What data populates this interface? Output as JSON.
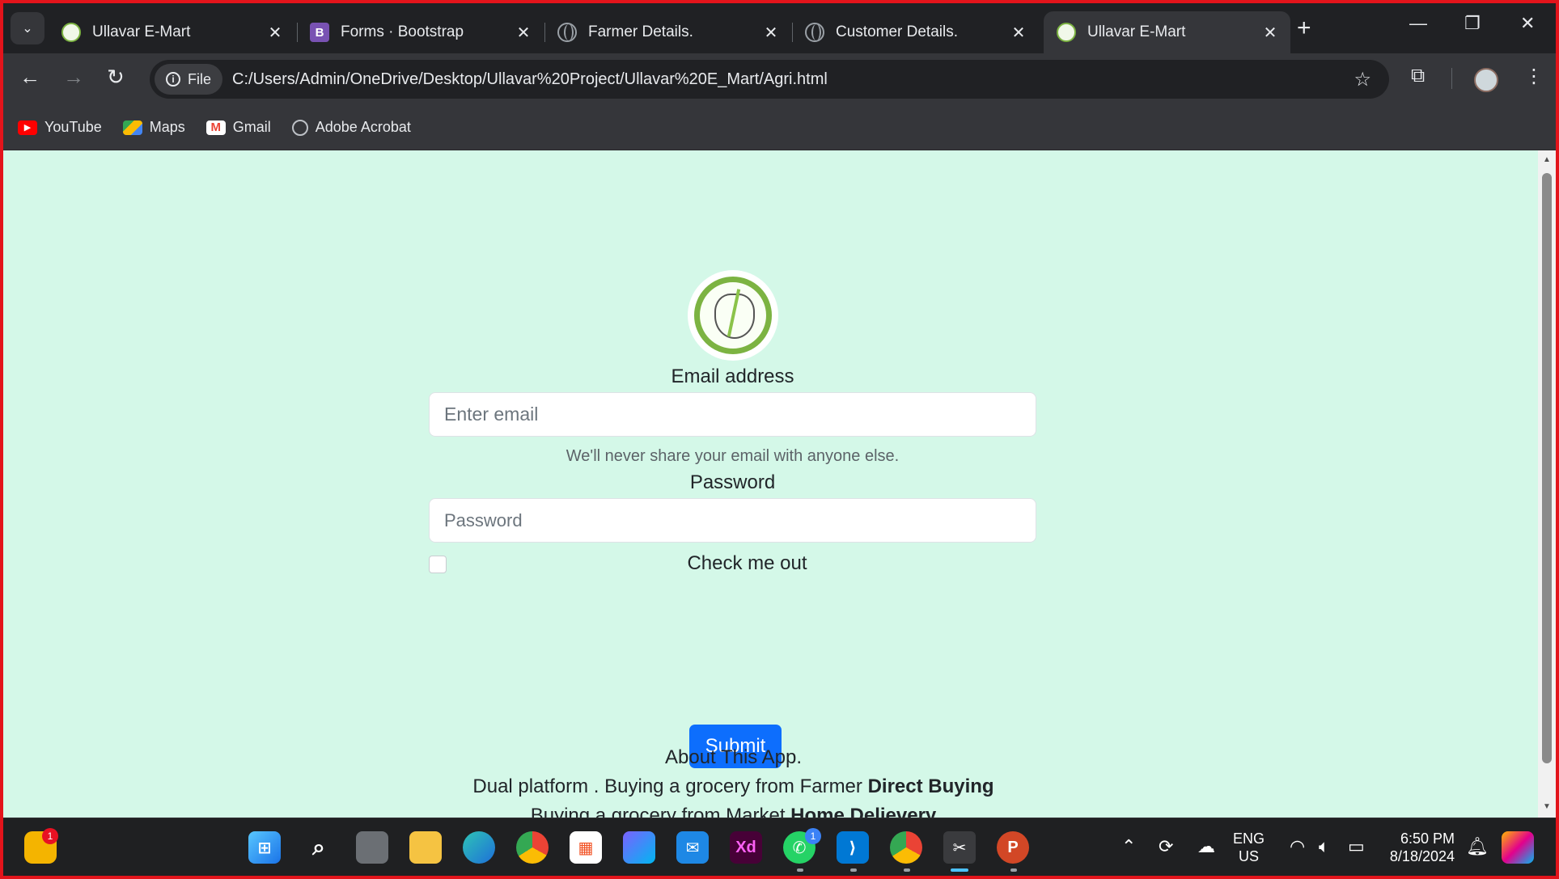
{
  "browser": {
    "tabs": [
      {
        "title": "Ullavar E-Mart",
        "icon": "ullavar-logo-icon"
      },
      {
        "title": "Forms · Bootstrap",
        "icon": "bootstrap-icon"
      },
      {
        "title": "Farmer Details.",
        "icon": "globe-icon"
      },
      {
        "title": "Customer Details.",
        "icon": "globe-icon"
      },
      {
        "title": "Ullavar E-Mart",
        "icon": "ullavar-logo-icon",
        "active": true
      }
    ],
    "site_chip": "File",
    "url": "C:/Users/Admin/OneDrive/Desktop/Ullavar%20Project/Ullavar%20E_Mart/Agri.html",
    "bookmarks": [
      {
        "label": "YouTube",
        "icon": "youtube-icon"
      },
      {
        "label": "Maps",
        "icon": "maps-icon"
      },
      {
        "label": "Gmail",
        "icon": "gmail-icon"
      },
      {
        "label": "Adobe Acrobat",
        "icon": "globe-icon"
      }
    ]
  },
  "page": {
    "background": "#d4f8e8",
    "logo_alt_text": "ULLAVAR E-MART",
    "form": {
      "email_label": "Email address",
      "email_placeholder": "Enter email",
      "email_help": "We'll never share your email with anyone else.",
      "password_label": "Password",
      "password_placeholder": "Password",
      "checkbox_label": "Check me out",
      "submit_label": "Submit",
      "submit_color": "#0d6efd"
    },
    "about": {
      "title": "About This App.",
      "line1_prefix": "Dual platform . Buying a grocery from Farmer ",
      "line1_bold": "Direct Buying",
      "line2_prefix": "Buying a grocery from Market ",
      "line2_bold": "Home Delievery"
    }
  },
  "taskbar": {
    "widget_badge": "1",
    "whatsapp_badge": "1",
    "lang_line1": "ENG",
    "lang_line2": "US",
    "time": "6:50 PM",
    "date": "8/18/2024"
  }
}
